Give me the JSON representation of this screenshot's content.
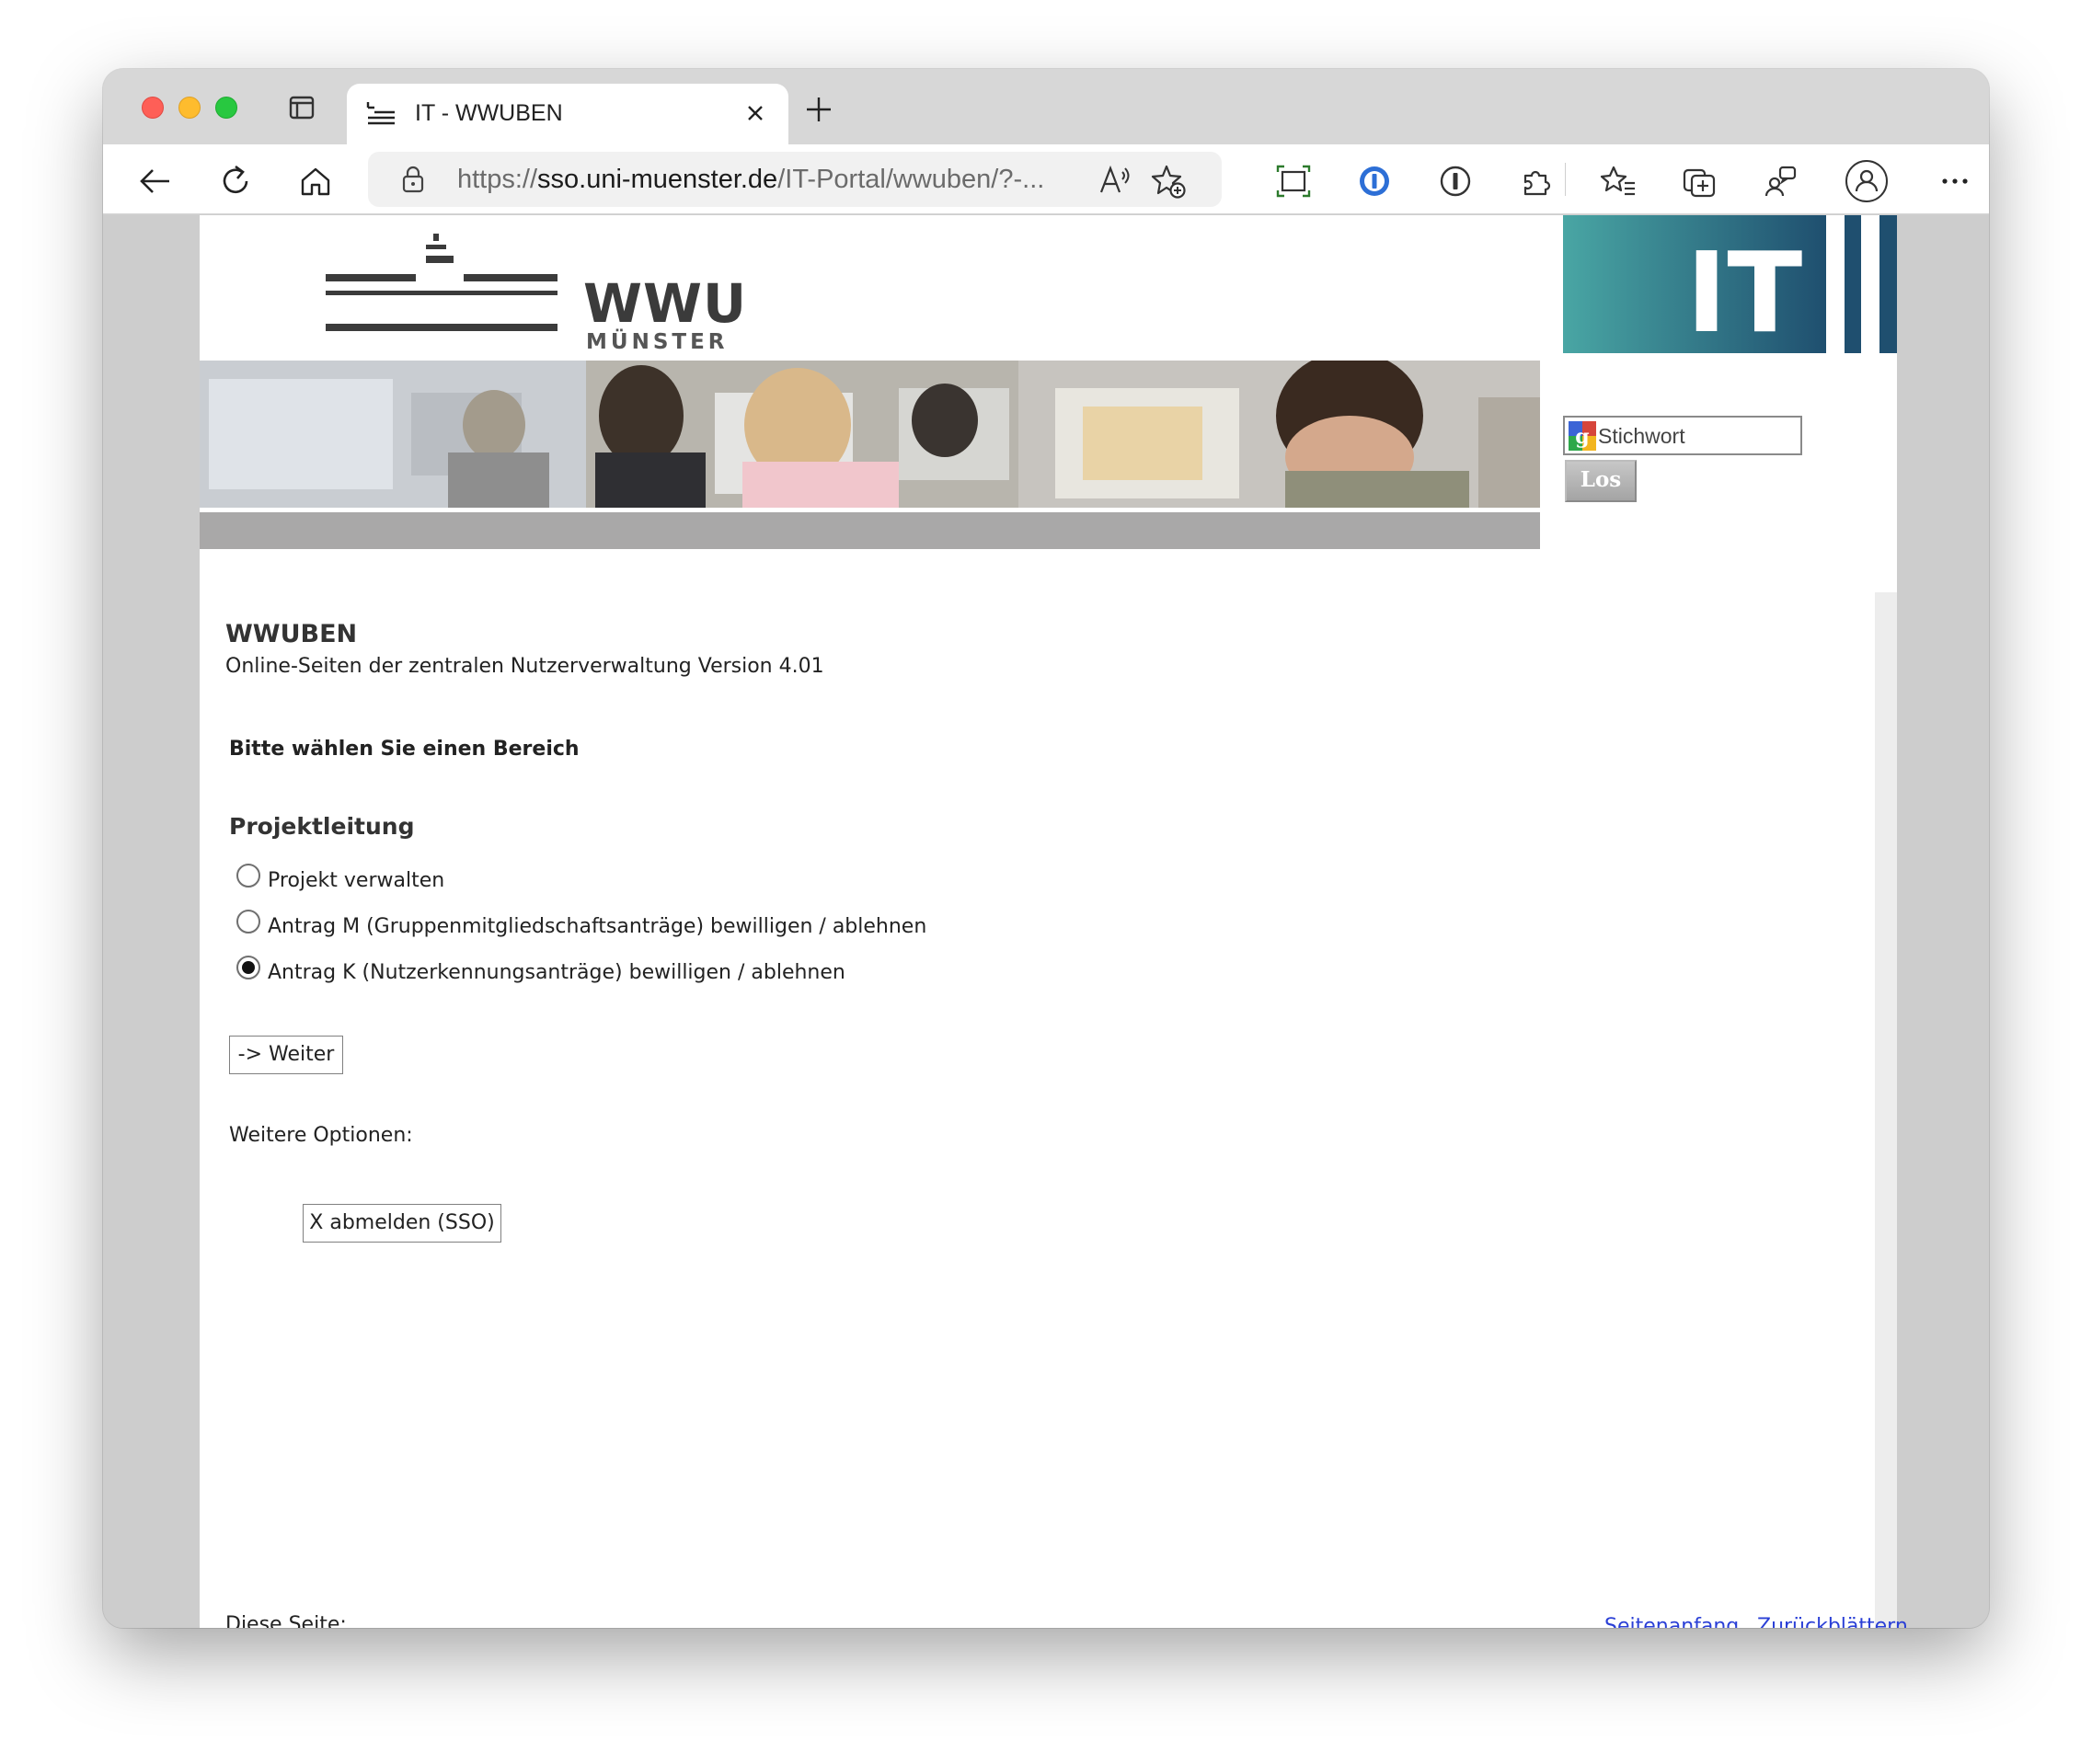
{
  "browser": {
    "tab_title": "IT - WWUBEN",
    "url_prefix": "https://",
    "url_host": "sso.uni-muenster.de",
    "url_path": "/IT-Portal/wwuben/?-..."
  },
  "header": {
    "logo_text": "WWU",
    "logo_subtext": "MÜNSTER",
    "it_logo_text": "IT",
    "search_placeholder": "Stichwort",
    "search_button": "Los"
  },
  "main": {
    "title": "WWUBEN",
    "subtitle": "Online-Seiten der zentralen Nutzerverwaltung Version 4.01",
    "choose_prompt": "Bitte wählen Sie einen Bereich",
    "section_heading": "Projektleitung",
    "options": [
      {
        "label": "Projekt verwalten",
        "checked": false
      },
      {
        "label": "Antrag M (Gruppenmitgliedschaftsanträge) bewilligen / ablehnen",
        "checked": false
      },
      {
        "label": "Antrag K (Nutzerkennungsanträge) bewilligen / ablehnen",
        "checked": true
      }
    ],
    "continue_button": "-> Weiter",
    "more_options_label": "Weitere Optionen:",
    "logout_button": "X abmelden (SSO)"
  },
  "footer": {
    "this_page_label": "Diese Seite:",
    "links": [
      "Seitenanfang",
      "Zurückblättern"
    ]
  },
  "colors": {
    "link": "#2a3fd6",
    "grey_bar": "#a9a8a8",
    "it_teal": "#3f9aa2",
    "it_navy": "#1d4f6b"
  }
}
